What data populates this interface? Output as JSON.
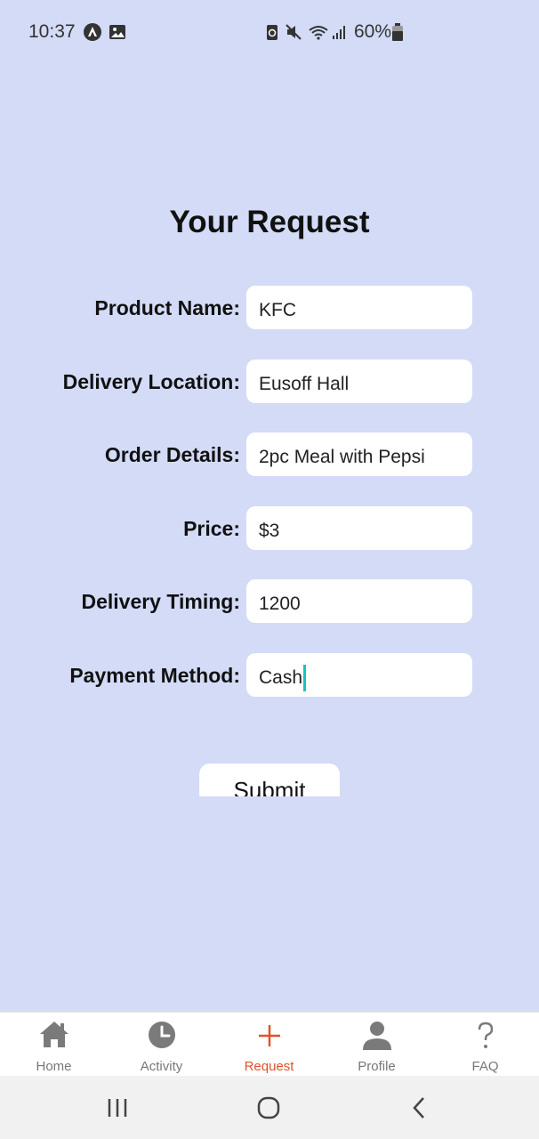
{
  "status_bar": {
    "time": "10:37",
    "battery": "60%"
  },
  "page": {
    "title": "Your Request"
  },
  "form": {
    "fields": [
      {
        "label": "Product Name:",
        "value": "KFC"
      },
      {
        "label": "Delivery Location:",
        "value": "Eusoff Hall"
      },
      {
        "label": "Order Details:",
        "value": "2pc Meal with Pepsi"
      },
      {
        "label": "Price:",
        "value": "$3"
      },
      {
        "label": "Delivery Timing:",
        "value": "1200"
      },
      {
        "label": "Payment Method:",
        "value": "Cash"
      }
    ],
    "submit_label": "Submit"
  },
  "bottom_nav": {
    "items": [
      {
        "label": "Home",
        "icon": "home-icon"
      },
      {
        "label": "Activity",
        "icon": "clock-icon"
      },
      {
        "label": "Request",
        "icon": "plus-icon",
        "active": true
      },
      {
        "label": "Profile",
        "icon": "person-icon"
      },
      {
        "label": "FAQ",
        "icon": "question-icon"
      }
    ]
  },
  "colors": {
    "background": "#d3dbf7",
    "accent": "#e0522e",
    "cursor": "#19c2c2"
  }
}
